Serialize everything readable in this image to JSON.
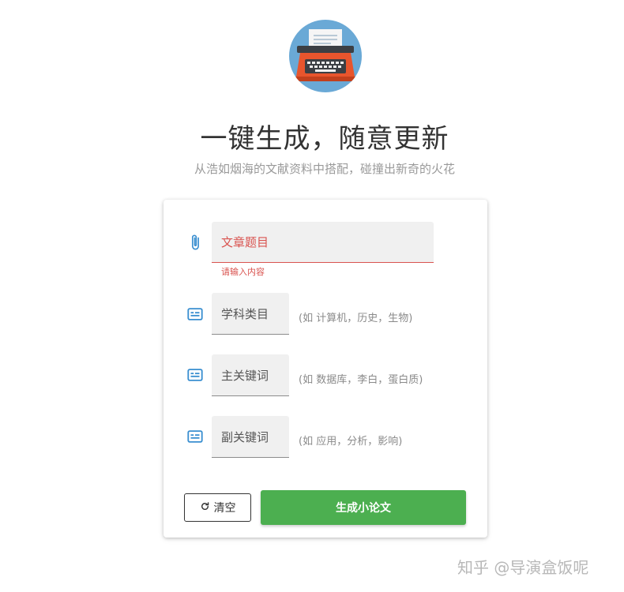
{
  "hero": {
    "title": "一键生成，随意更新",
    "subtitle": "从浩如烟海的文献资料中搭配，碰撞出新奇的火花"
  },
  "form": {
    "title_field": {
      "placeholder": "文章题目",
      "error": "请输入内容",
      "icon": "paperclip-icon"
    },
    "subject_field": {
      "placeholder": "学科类目",
      "hint": "(如 计算机，历史，生物)",
      "icon": "subtitles-icon"
    },
    "main_keyword_field": {
      "placeholder": "主关键词",
      "hint": "(如 数据库，李白，蛋白质)",
      "icon": "subtitles-icon"
    },
    "sub_keyword_field": {
      "placeholder": "副关键词",
      "hint": "(如 应用，分析，影响)",
      "icon": "subtitles-icon"
    },
    "clear_label": "清空",
    "generate_label": "生成小论文"
  },
  "watermark": "知乎 @导演盒饭呢",
  "colors": {
    "accent": "#4caf50",
    "error": "#d9534f",
    "icon": "#3a8fd0",
    "logo_bg": "#6aa9d6",
    "typewriter": "#e8552d"
  }
}
